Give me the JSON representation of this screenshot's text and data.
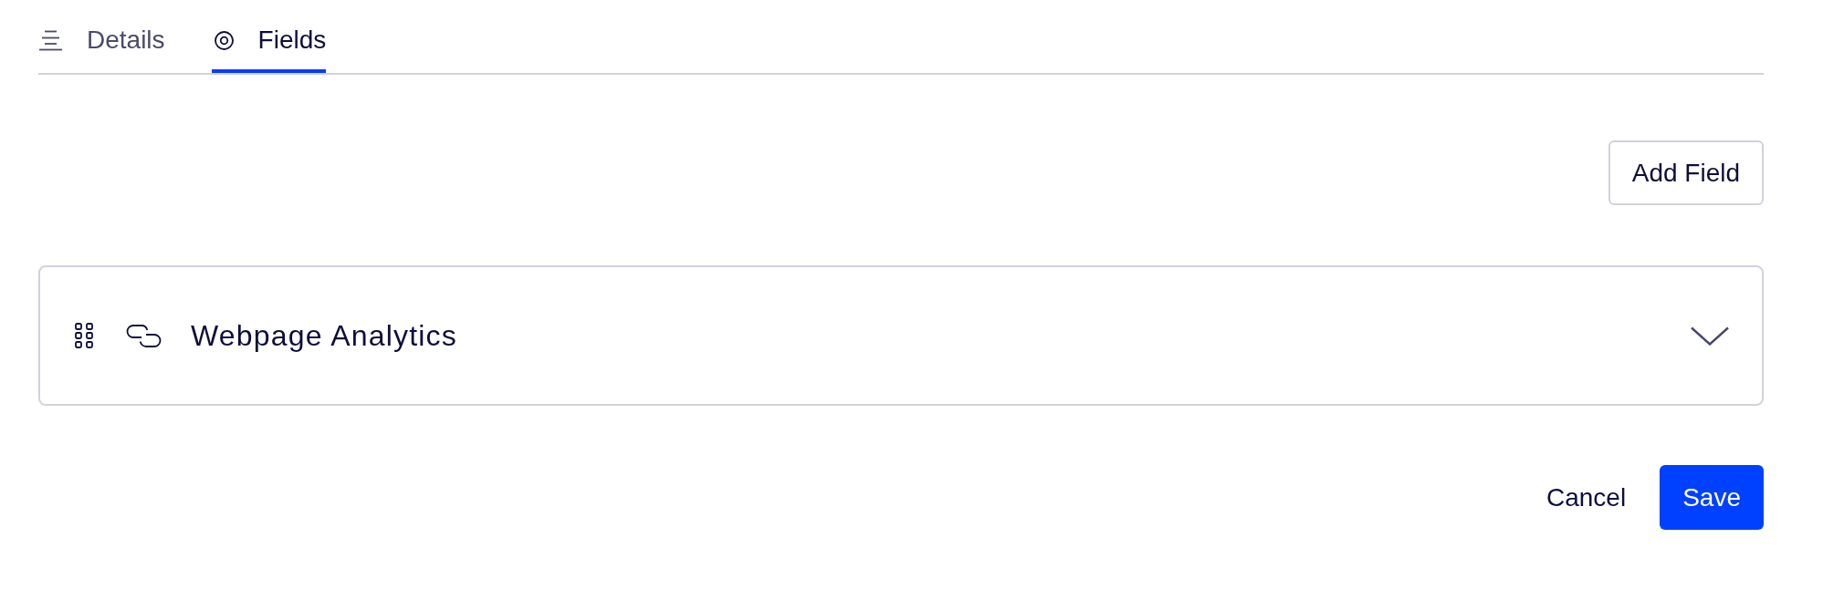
{
  "tabs": [
    {
      "label": "Details",
      "selected": false
    },
    {
      "label": "Fields",
      "selected": true
    }
  ],
  "add_button": "Add Field",
  "fields": [
    {
      "title": "Webpage Analytics",
      "expanded": false
    }
  ],
  "actions": {
    "cancel": "Cancel",
    "save": "Save"
  }
}
